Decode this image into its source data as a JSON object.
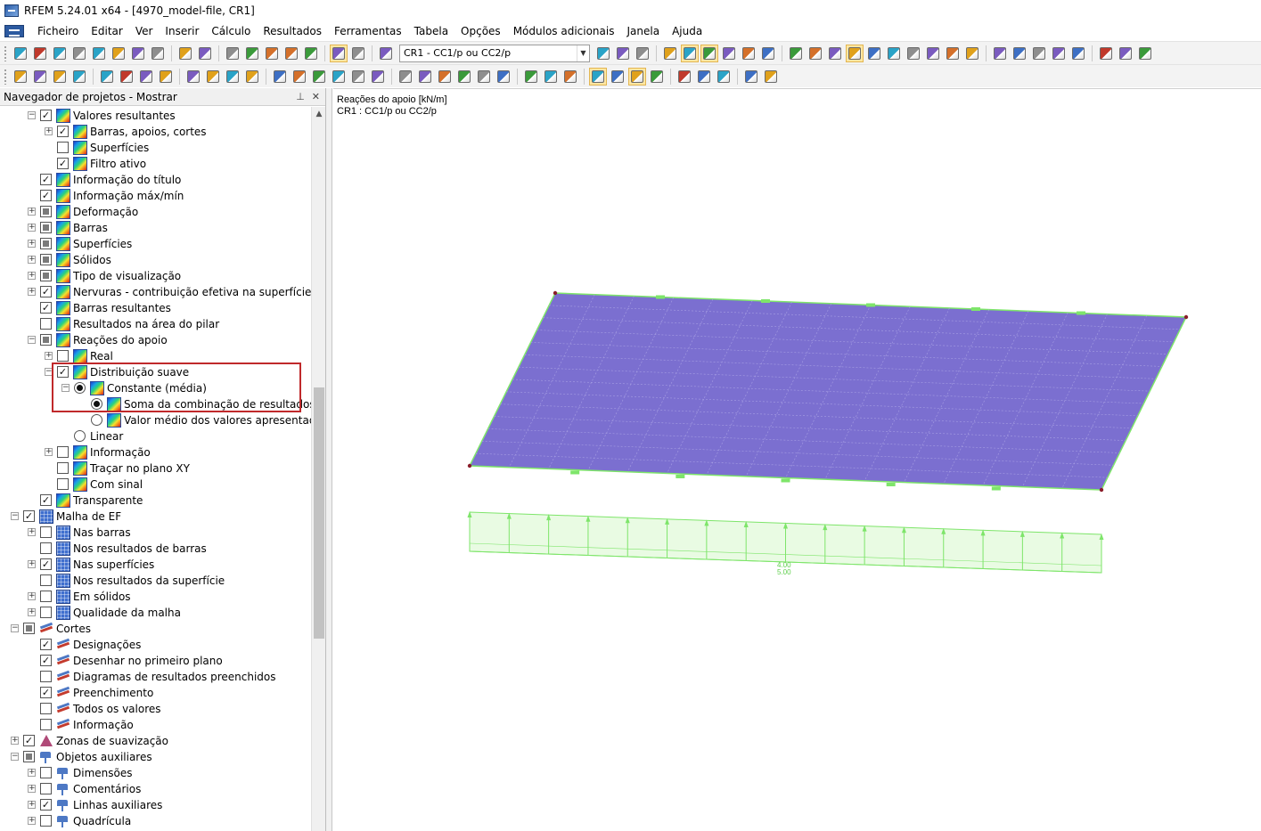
{
  "window": {
    "title": "RFEM 5.24.01 x64 - [4970_model-file, CR1]"
  },
  "menu": [
    "Ficheiro",
    "Editar",
    "Ver",
    "Inserir",
    "Cálculo",
    "Resultados",
    "Ferramentas",
    "Tabela",
    "Opções",
    "Módulos adicionais",
    "Janela",
    "Ajuda"
  ],
  "toolbar": {
    "combo_value": "CR1 - CC1/p ou CC2/p",
    "row1_left_icons": [
      "new-file-icon",
      "open-folder-icon",
      "open-model-icon",
      "save-all-icon",
      "save-icon",
      "print-icon",
      "print-preview-icon",
      "print-report-icon",
      "undo-icon",
      "redo-icon",
      "edit-pencil-icon",
      "find-icon",
      "target-icon",
      "zoom-window-icon",
      "open-window-icon",
      "table-view-icon",
      "grid-view-icon",
      "results-flag-icon"
    ],
    "row1_right_icons": [
      "previous-icon",
      "next-icon",
      "pin-icon",
      "show-values-icon",
      "show-results-icon",
      "results-values-icon",
      "view-settings-icon",
      "print-graphic-icon",
      "print-table-icon",
      "model-grid-icon",
      "mesh-icon",
      "structure-view-icon",
      "iso-view-icon",
      "move-icon",
      "rotate-icon",
      "copy-icon",
      "pointer-icon",
      "measure-icon",
      "mirror-icon",
      "delete-icon",
      "options-icon",
      "calculator-icon",
      "check-icon",
      "export-icon",
      "import-icon",
      "flag-icon",
      "pushpin-icon"
    ],
    "row2_icons": [
      "node-icon",
      "line-icon",
      "member-icon",
      "support-icon",
      "load-icon",
      "surface-icon",
      "solid-icon",
      "opening-icon",
      "display-icon",
      "dimension-icon",
      "coordinate-icon",
      "set-icon",
      "section-icon",
      "cut-icon",
      "result-line-icon",
      "box-icon",
      "copy-view-icon",
      "cube-icon",
      "iso-icon",
      "x-axis-icon",
      "y-axis-icon",
      "z-axis-icon",
      "minus-x-icon",
      "render-icon",
      "color-icon",
      "lines-icon",
      "fill-icon",
      "surface-display-icon",
      "shading-icon",
      "light-icon",
      "perspective-icon",
      "wireframe-icon",
      "grid-toggle-icon",
      "panel-icon",
      "chart-icon",
      "color-scale-icon"
    ]
  },
  "navigator": {
    "title": "Navegador de projetos - Mostrar",
    "items": [
      {
        "label": "Valores resultantes",
        "level": 1,
        "expander": "-",
        "check": "checked",
        "icon": "results"
      },
      {
        "label": "Barras, apoios, cortes",
        "level": 2,
        "expander": "+",
        "check": "checked",
        "icon": "results"
      },
      {
        "label": "Superfícies",
        "level": 2,
        "expander": "",
        "check": "unchecked",
        "icon": "results"
      },
      {
        "label": "Filtro ativo",
        "level": 2,
        "expander": "",
        "check": "checked",
        "icon": "results"
      },
      {
        "label": "Informação do título",
        "level": 1,
        "expander": "",
        "check": "checked",
        "icon": "results"
      },
      {
        "label": "Informação máx/mín",
        "level": 1,
        "expander": "",
        "check": "checked",
        "icon": "results"
      },
      {
        "label": "Deformação",
        "level": 1,
        "expander": "+",
        "check": "partial",
        "icon": "results"
      },
      {
        "label": "Barras",
        "level": 1,
        "expander": "+",
        "check": "partial",
        "icon": "results"
      },
      {
        "label": "Superfícies",
        "level": 1,
        "expander": "+",
        "check": "partial",
        "icon": "results"
      },
      {
        "label": "Sólidos",
        "level": 1,
        "expander": "+",
        "check": "partial",
        "icon": "results"
      },
      {
        "label": "Tipo de visualização",
        "level": 1,
        "expander": "+",
        "check": "partial",
        "icon": "results"
      },
      {
        "label": "Nervuras - contribuição efetiva na superfície/barra",
        "level": 1,
        "expander": "+",
        "check": "checked",
        "icon": "results"
      },
      {
        "label": "Barras resultantes",
        "level": 1,
        "expander": "",
        "check": "checked",
        "icon": "results"
      },
      {
        "label": "Resultados na área do pilar",
        "level": 1,
        "expander": "",
        "check": "unchecked",
        "icon": "results"
      },
      {
        "label": "Reações do apoio",
        "level": 1,
        "expander": "-",
        "check": "partial",
        "icon": "results"
      },
      {
        "label": "Real",
        "level": 2,
        "expander": "+",
        "check": "unchecked",
        "icon": "results"
      },
      {
        "label": "Distribuição suave",
        "level": 2,
        "expander": "-",
        "check": "checked",
        "icon": "results"
      },
      {
        "label": "Constante (média)",
        "level": 3,
        "expander": "-",
        "radio": "on",
        "icon": "results"
      },
      {
        "label": "Soma da combinação de resultados",
        "level": 4,
        "expander": "",
        "radio": "on",
        "icon": "results"
      },
      {
        "label": "Valor médio dos valores apresentados",
        "level": 4,
        "expander": "",
        "radio": "off",
        "icon": "results"
      },
      {
        "label": "Linear",
        "level": 3,
        "expander": "",
        "radio": "off",
        "icon": ""
      },
      {
        "label": "Informação",
        "level": 2,
        "expander": "+",
        "check": "unchecked",
        "icon": "results"
      },
      {
        "label": "Traçar no plano XY",
        "level": 2,
        "expander": "",
        "check": "unchecked",
        "icon": "results"
      },
      {
        "label": "Com sinal",
        "level": 2,
        "expander": "",
        "check": "unchecked",
        "icon": "results"
      },
      {
        "label": "Transparente",
        "level": 1,
        "expander": "",
        "check": "checked",
        "icon": "results"
      },
      {
        "label": "Malha de EF",
        "level": 0,
        "expander": "-",
        "check": "checked",
        "icon": "mesh"
      },
      {
        "label": "Nas barras",
        "level": 1,
        "expander": "+",
        "check": "unchecked",
        "icon": "mesh"
      },
      {
        "label": "Nos resultados de barras",
        "level": 1,
        "expander": "",
        "check": "unchecked",
        "icon": "mesh"
      },
      {
        "label": "Nas superfícies",
        "level": 1,
        "expander": "+",
        "check": "checked",
        "icon": "mesh"
      },
      {
        "label": "Nos resultados da superfície",
        "level": 1,
        "expander": "",
        "check": "unchecked",
        "icon": "mesh"
      },
      {
        "label": "Em sólidos",
        "level": 1,
        "expander": "+",
        "check": "unchecked",
        "icon": "mesh"
      },
      {
        "label": "Qualidade da malha",
        "level": 1,
        "expander": "+",
        "check": "unchecked",
        "icon": "mesh"
      },
      {
        "label": "Cortes",
        "level": 0,
        "expander": "-",
        "check": "partial",
        "icon": "section"
      },
      {
        "label": "Designações",
        "level": 1,
        "expander": "",
        "check": "checked",
        "icon": "section"
      },
      {
        "label": "Desenhar no primeiro plano",
        "level": 1,
        "expander": "",
        "check": "checked",
        "icon": "section"
      },
      {
        "label": "Diagramas de resultados preenchidos",
        "level": 1,
        "expander": "",
        "check": "unchecked",
        "icon": "section"
      },
      {
        "label": "Preenchimento",
        "level": 1,
        "expander": "",
        "check": "checked",
        "icon": "section"
      },
      {
        "label": "Todos os valores",
        "level": 1,
        "expander": "",
        "check": "unchecked",
        "icon": "section"
      },
      {
        "label": "Informação",
        "level": 1,
        "expander": "",
        "check": "unchecked",
        "icon": "section"
      },
      {
        "label": "Zonas de suavização",
        "level": 0,
        "expander": "+",
        "check": "checked",
        "icon": "smooth"
      },
      {
        "label": "Objetos auxiliares",
        "level": 0,
        "expander": "-",
        "check": "partial",
        "icon": "aux"
      },
      {
        "label": "Dimensões",
        "level": 1,
        "expander": "+",
        "check": "unchecked",
        "icon": "aux"
      },
      {
        "label": "Comentários",
        "level": 1,
        "expander": "+",
        "check": "unchecked",
        "icon": "aux"
      },
      {
        "label": "Linhas auxiliares",
        "level": 1,
        "expander": "+",
        "check": "checked",
        "icon": "aux"
      },
      {
        "label": "Quadrícula",
        "level": 1,
        "expander": "+",
        "check": "unchecked",
        "icon": "aux"
      }
    ]
  },
  "viewport": {
    "caption_line1": "Reações do apoio [kN/m]",
    "caption_line2": "CR1 : CC1/p ou CC2/p",
    "value_label_1": "4.00",
    "value_label_2": "5.00",
    "colors": {
      "plate": "#7b6fd0",
      "plate_edge": "#7ee56a",
      "grid": "#a79fe3",
      "support": "#7ee56a",
      "node": "#8a1d2a"
    }
  }
}
